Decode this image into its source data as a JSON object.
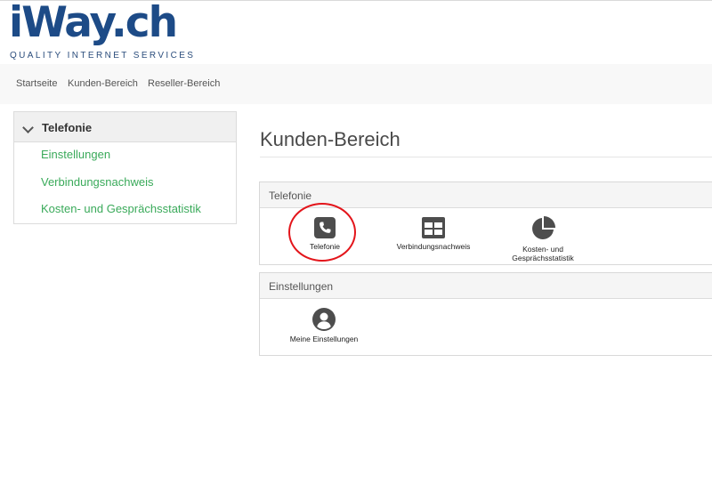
{
  "brand": {
    "logo_text": "iWay.ch",
    "tagline": "QUALITY INTERNET SERVICES"
  },
  "nav": {
    "items": [
      "Startseite",
      "Kunden-Bereich",
      "Reseller-Bereich"
    ]
  },
  "sidebar": {
    "heading": "Telefonie",
    "items": [
      "Einstellungen",
      "Verbindungsnachweis",
      "Kosten- und Gesprächsstatistik"
    ]
  },
  "main": {
    "title": "Kunden-Bereich",
    "panels": [
      {
        "heading": "Telefonie",
        "tiles": [
          {
            "label": "Telefonie",
            "icon": "phone-icon"
          },
          {
            "label": "Verbindungsnachweis",
            "icon": "table-icon"
          },
          {
            "label_line1": "Kosten- und",
            "label_line2": "Gesprächsstatistik",
            "icon": "pie-chart-icon"
          }
        ]
      },
      {
        "heading": "Einstellungen",
        "tiles": [
          {
            "label": "Meine Einstellungen",
            "icon": "user-icon"
          }
        ]
      }
    ]
  },
  "colors": {
    "brand": "#1d4b87",
    "link": "#3aaa5a",
    "highlight": "#e3151b",
    "icon": "#4d4d4d"
  }
}
